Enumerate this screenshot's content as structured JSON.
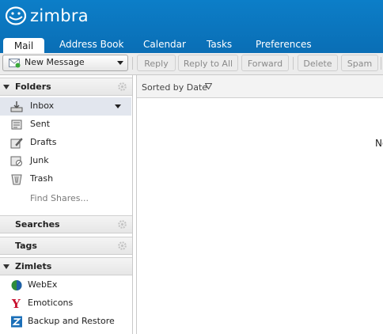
{
  "app": {
    "logo_text": "zimbra"
  },
  "tabs": [
    {
      "label": "Mail",
      "active": true
    },
    {
      "label": "Address Book"
    },
    {
      "label": "Calendar"
    },
    {
      "label": "Tasks"
    },
    {
      "label": "Preferences"
    }
  ],
  "toolbar": {
    "new_message": "New Message",
    "reply": "Reply",
    "reply_all": "Reply to All",
    "forward": "Forward",
    "delete": "Delete",
    "spam": "Spam"
  },
  "sidebar": {
    "folders_title": "Folders",
    "folders": [
      {
        "label": "Inbox",
        "icon": "inbox-icon",
        "selected": true
      },
      {
        "label": "Sent",
        "icon": "sent-icon"
      },
      {
        "label": "Drafts",
        "icon": "drafts-icon"
      },
      {
        "label": "Junk",
        "icon": "junk-icon"
      },
      {
        "label": "Trash",
        "icon": "trash-icon"
      }
    ],
    "find_shares": "Find Shares...",
    "searches_title": "Searches",
    "tags_title": "Tags",
    "zimlets_title": "Zimlets",
    "zimlets": [
      {
        "label": "WebEx",
        "icon": "webex-icon"
      },
      {
        "label": "Emoticons",
        "icon": "emoticons-icon"
      },
      {
        "label": "Backup and Restore",
        "icon": "backup-icon"
      }
    ]
  },
  "list": {
    "sorted_by": "Sorted by Date",
    "empty_text": "No"
  },
  "colors": {
    "header": "#0a6eb5",
    "selected_row": "#e2e6ee"
  }
}
